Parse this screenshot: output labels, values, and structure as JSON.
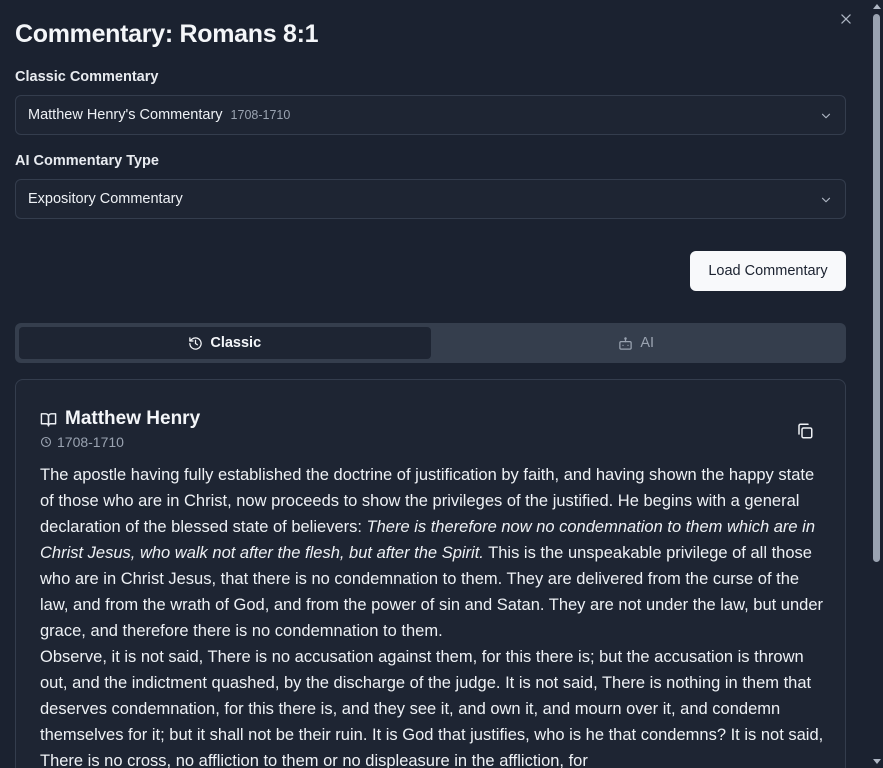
{
  "dialog": {
    "title": "Commentary: Romans 8:1",
    "close_icon": "close-icon"
  },
  "classic": {
    "label": "Classic Commentary",
    "selected": "Matthew Henry's Commentary",
    "selected_years": "1708-1710"
  },
  "ai": {
    "label": "AI Commentary Type",
    "selected": "Expository Commentary"
  },
  "load_button": "Load Commentary",
  "tabs": [
    {
      "label": "Classic",
      "icon": "history-icon",
      "active": true
    },
    {
      "label": "AI",
      "icon": "bot-icon",
      "active": false
    }
  ],
  "card": {
    "title": "Matthew Henry",
    "date": "1708-1710",
    "paragraph1_a": "The apostle having fully established the doctrine of justification by faith, and having shown the happy state of those who are in Christ, now proceeds to show the privileges of the justified. He begins with a general declaration of the blessed state of believers: ",
    "paragraph1_quote": "There is therefore now no condemnation to them which are in Christ Jesus, who walk not after the flesh, but after the Spirit.",
    "paragraph1_b": " This is the unspeakable privilege of all those who are in Christ Jesus, that there is no condemnation to them. They are delivered from the curse of the law, and from the wrath of God, and from the power of sin and Satan. They are not under the law, but under grace, and therefore there is no condemnation to them.",
    "paragraph2": "Observe, it is not said, There is no accusation against them, for this there is; but the accusation is thrown out, and the indictment quashed, by the discharge of the judge. It is not said, There is nothing in them that deserves condemnation, for this there is, and they see it, and own it, and mourn over it, and condemn themselves for it; but it shall not be their ruin. It is God that justifies, who is he that condemns? It is not said, There is no cross, no affliction to them or no displeasure in the affliction, for"
  }
}
